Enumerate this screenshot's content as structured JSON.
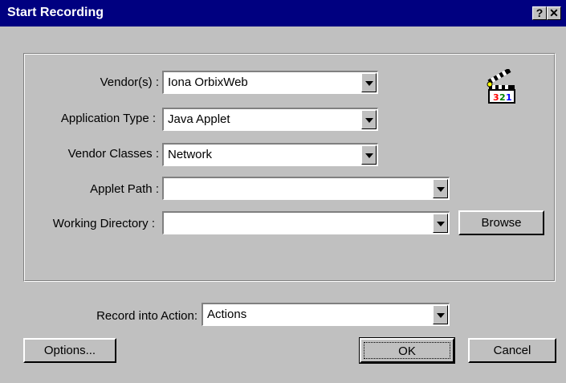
{
  "window": {
    "title": "Start Recording",
    "help_button": "?",
    "close_button": "✕"
  },
  "form": {
    "vendors": {
      "label": "Vendor(s) :",
      "value": "Iona OrbixWeb"
    },
    "application_type": {
      "label": "Application Type :",
      "value": "Java Applet"
    },
    "vendor_classes": {
      "label": "Vendor Classes :",
      "value": "Network"
    },
    "applet_path": {
      "label": "Applet Path :",
      "value": ""
    },
    "working_directory": {
      "label": "Working Directory :",
      "value": ""
    },
    "browse_label": "Browse",
    "icon": {
      "name": "clapperboard-icon",
      "digits": [
        "3",
        "2",
        "1"
      ],
      "digit_colors": [
        "#ff0000",
        "#008000",
        "#0000ff"
      ]
    }
  },
  "record_into": {
    "label": "Record into Action:",
    "value": "Actions"
  },
  "buttons": {
    "options": "Options...",
    "ok": "OK",
    "cancel": "Cancel"
  }
}
